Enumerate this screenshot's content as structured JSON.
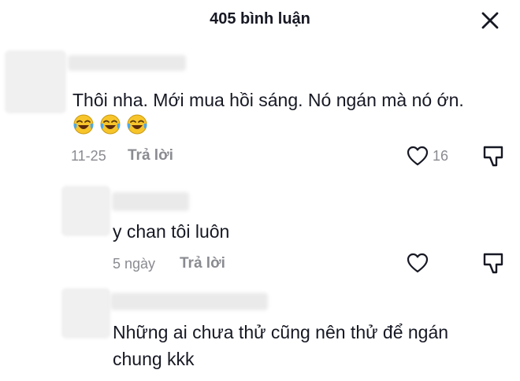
{
  "header": {
    "title": "405 bình luận"
  },
  "comments": [
    {
      "text": "Thôi nha. Mới mua hồi sáng. Nó ngán mà nó ớn.",
      "emojis": "😂😂😂",
      "date": "11-25",
      "reply_label": "Trả lời",
      "likes": "16"
    },
    {
      "text": "y chan tôi luôn",
      "date": "5 ngày",
      "reply_label": "Trả lời"
    },
    {
      "text_line1": "Những ai chưa thử cũng nên thử để ngán",
      "text_line2": "chung kkk"
    }
  ],
  "icons": {
    "close": "close-icon",
    "like": "heart-outline-icon",
    "dislike": "thumbs-down-icon"
  }
}
